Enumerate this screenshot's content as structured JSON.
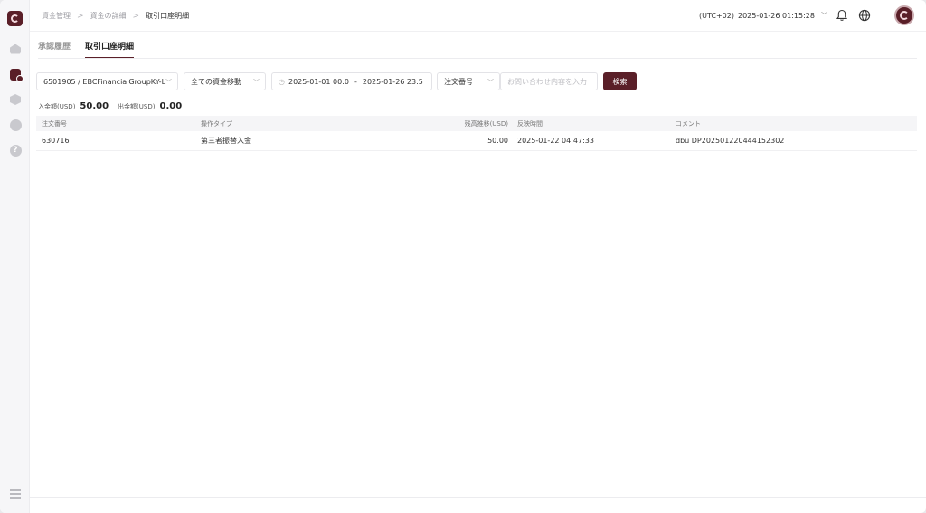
{
  "breadcrumb": {
    "items": [
      "資金管理",
      "資金の詳細",
      "取引口座明細"
    ],
    "separator": ">"
  },
  "header": {
    "timezone": "(UTC+02)",
    "datetime": "2025-01-26 01:15:28"
  },
  "tabs": [
    "承認履歴",
    "取引口座明細"
  ],
  "active_tab": 1,
  "filters": {
    "account": "6501905 / EBCFinancialGroupKY-L",
    "movement_type": "全ての資金移動",
    "date_start": "2025-01-01 00:0",
    "date_separator": "-",
    "date_end": "2025-01-26 23:5",
    "search_field": "注文番号",
    "search_placeholder": "お問い合わせ内容を入力",
    "search_button": "検索"
  },
  "totals": {
    "deposit_label": "入金額(USD)",
    "deposit_value": "50.00",
    "withdraw_label": "出金額(USD)",
    "withdraw_value": "0.00"
  },
  "table": {
    "headers": [
      "注文番号",
      "操作タイプ",
      "残高推移(USD)",
      "反映時間",
      "コメント"
    ],
    "rows": [
      [
        "630716",
        "第三者振替入金",
        "50.00",
        "2025-01-22 04:47:33",
        "dbu DP202501220444152302"
      ]
    ]
  },
  "colors": {
    "brand": "#5a1f28",
    "sidebar_bg": "#f6f6f8"
  },
  "icons": [
    "home-icon",
    "funds-icon",
    "cube-icon",
    "user-icon",
    "help-icon",
    "collapse-menu-icon",
    "bell-icon",
    "globe-icon"
  ]
}
